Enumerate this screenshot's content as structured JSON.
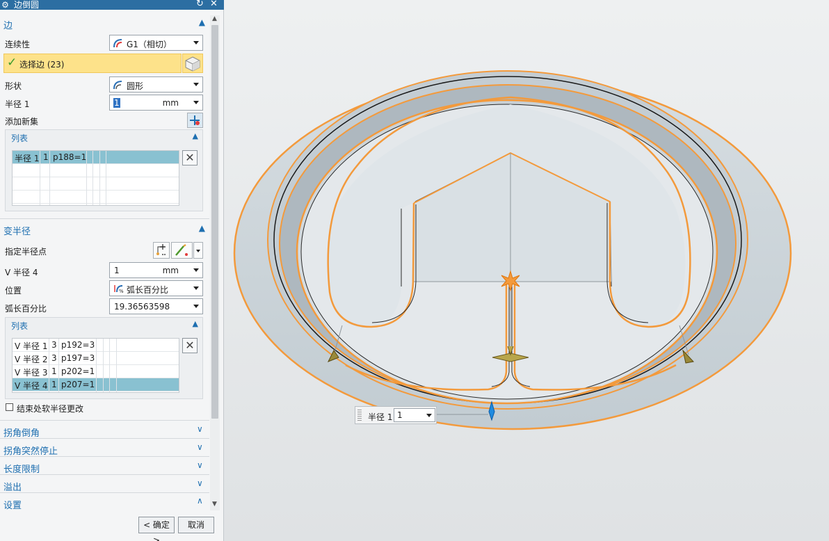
{
  "dialog": {
    "title": "边倒圆",
    "accent_color": "#2c6ea2",
    "icons": {
      "title": "gear-icon",
      "reset": "reset-icon",
      "close": "close-icon"
    }
  },
  "edge_section": {
    "title": "边",
    "continuity": {
      "label": "连续性",
      "value": "G1（相切）"
    },
    "select_edge": {
      "label": "选择边 (23)"
    },
    "shape": {
      "label": "形状",
      "value": "圆形"
    },
    "radius1": {
      "label": "半径 1",
      "value": "1",
      "unit": "mm"
    },
    "add_new_set": {
      "label": "添加新集"
    },
    "list": {
      "title": "列表",
      "rows": [
        {
          "name": "半径 1",
          "count": "1",
          "expr": "p188=1"
        }
      ]
    }
  },
  "variable_radius": {
    "title": "变半径",
    "specify_point": {
      "label": "指定半径点"
    },
    "v_radius": {
      "label": "V 半径 4",
      "value": "1",
      "unit": "mm"
    },
    "position": {
      "label": "位置",
      "value": "弧长百分比"
    },
    "arc_percent": {
      "label": "弧长百分比",
      "value": "19.36563598"
    },
    "list": {
      "title": "列表",
      "rows": [
        {
          "name": "V 半径 1",
          "count": "3",
          "expr": "p192=3"
        },
        {
          "name": "V 半径 2",
          "count": "3",
          "expr": "p197=3"
        },
        {
          "name": "V 半径 3",
          "count": "1",
          "expr": "p202=1"
        },
        {
          "name": "V 半径 4",
          "count": "1",
          "expr": "p207=1"
        }
      ]
    },
    "soft_end": {
      "label": "结束处软半径更改",
      "checked": false
    }
  },
  "collapsed_sections": [
    {
      "title": "拐角倒角"
    },
    {
      "title": "拐角突然停止"
    },
    {
      "title": "长度限制"
    },
    {
      "title": "溢出"
    },
    {
      "title": "设置"
    }
  ],
  "buttons": {
    "ok": "< 确定 >",
    "cancel": "取消"
  },
  "viewport": {
    "radius_widget": {
      "label": "半径 1",
      "value": "1"
    },
    "highlight_color": "#f39a3c"
  }
}
